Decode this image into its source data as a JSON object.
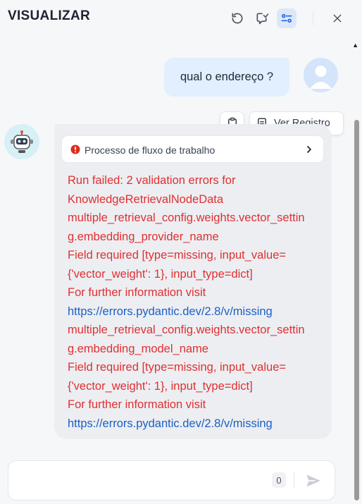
{
  "header": {
    "title": "VISUALIZAR",
    "icons": [
      "restart-icon",
      "chat-edit-icon",
      "settings-sliders-icon",
      "close-icon"
    ]
  },
  "messages": {
    "user_text": "qual o endereço ?",
    "toolbar": {
      "log_label": "Ver Registro"
    },
    "workflow_label": "Processo de fluxo de trabalho",
    "error_lines": [
      "Run failed: 2 validation errors for",
      "KnowledgeRetrievalNodeData",
      "multiple_retrieval_config.weights.vector_settin",
      "g.embedding_provider_name",
      "Field required [type=missing, input_value=",
      "{'vector_weight': 1}, input_type=dict]",
      "For further information visit",
      "https://errors.pydantic.dev/2.8/v/missing",
      "multiple_retrieval_config.weights.vector_settin",
      "g.embedding_model_name",
      "Field required [type=missing, input_value=",
      "{'vector_weight': 1}, input_type=dict]",
      "For further information visit",
      "https://errors.pydantic.dev/2.8/v/missing"
    ]
  },
  "composer": {
    "value": "",
    "placeholder": "",
    "count": "0"
  },
  "colors": {
    "error": "#e03030",
    "link": "#1d5fc4",
    "user_bubble": "#e1effe",
    "bot_bubble": "#eceef2",
    "accent": "#1c64f2"
  }
}
